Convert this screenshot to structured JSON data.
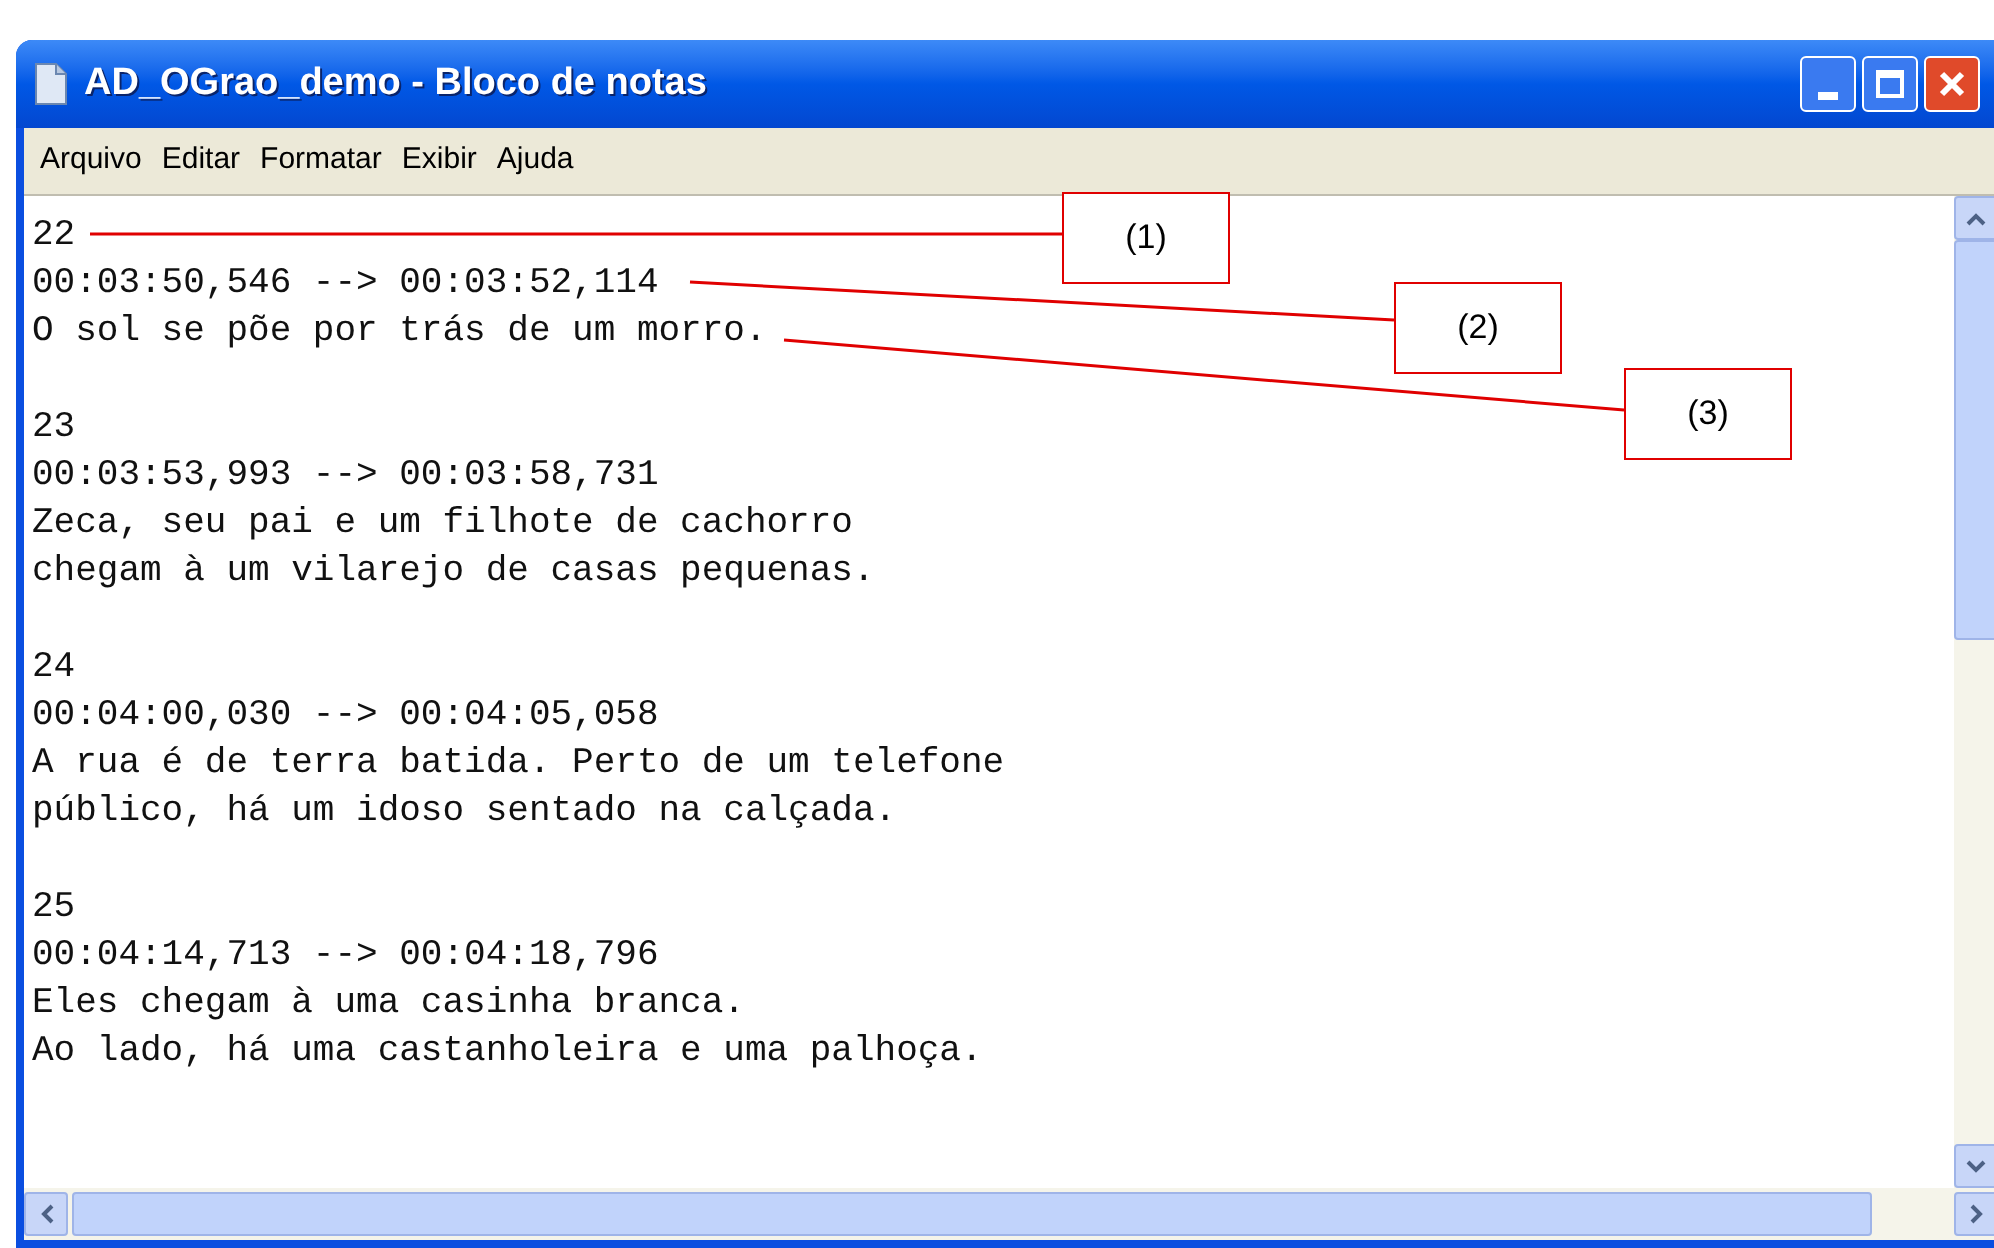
{
  "window": {
    "title": "AD_OGrao_demo - Bloco de notas"
  },
  "menu": [
    "Arquivo",
    "Editar",
    "Formatar",
    "Exibir",
    "Ajuda"
  ],
  "entries": [
    {
      "number": "22",
      "timecode": "00:03:50,546 --> 00:03:52,114",
      "lines": [
        "O sol se põe por trás de um morro."
      ]
    },
    {
      "number": "23",
      "timecode": "00:03:53,993 --> 00:03:58,731",
      "lines": [
        "Zeca, seu pai e um filhote de cachorro",
        "chegam à um vilarejo de casas pequenas."
      ]
    },
    {
      "number": "24",
      "timecode": "00:04:00,030 --> 00:04:05,058",
      "lines": [
        "A rua é de terra batida. Perto de um telefone",
        "público, há um idoso sentado na calçada."
      ]
    },
    {
      "number": "25",
      "timecode": "00:04:14,713 --> 00:04:18,796",
      "lines": [
        "Eles chegam à uma casinha branca.",
        "Ao lado, há uma castanholeira e uma palhoça."
      ]
    }
  ],
  "callouts": [
    "(1)",
    "(2)",
    "(3)"
  ]
}
